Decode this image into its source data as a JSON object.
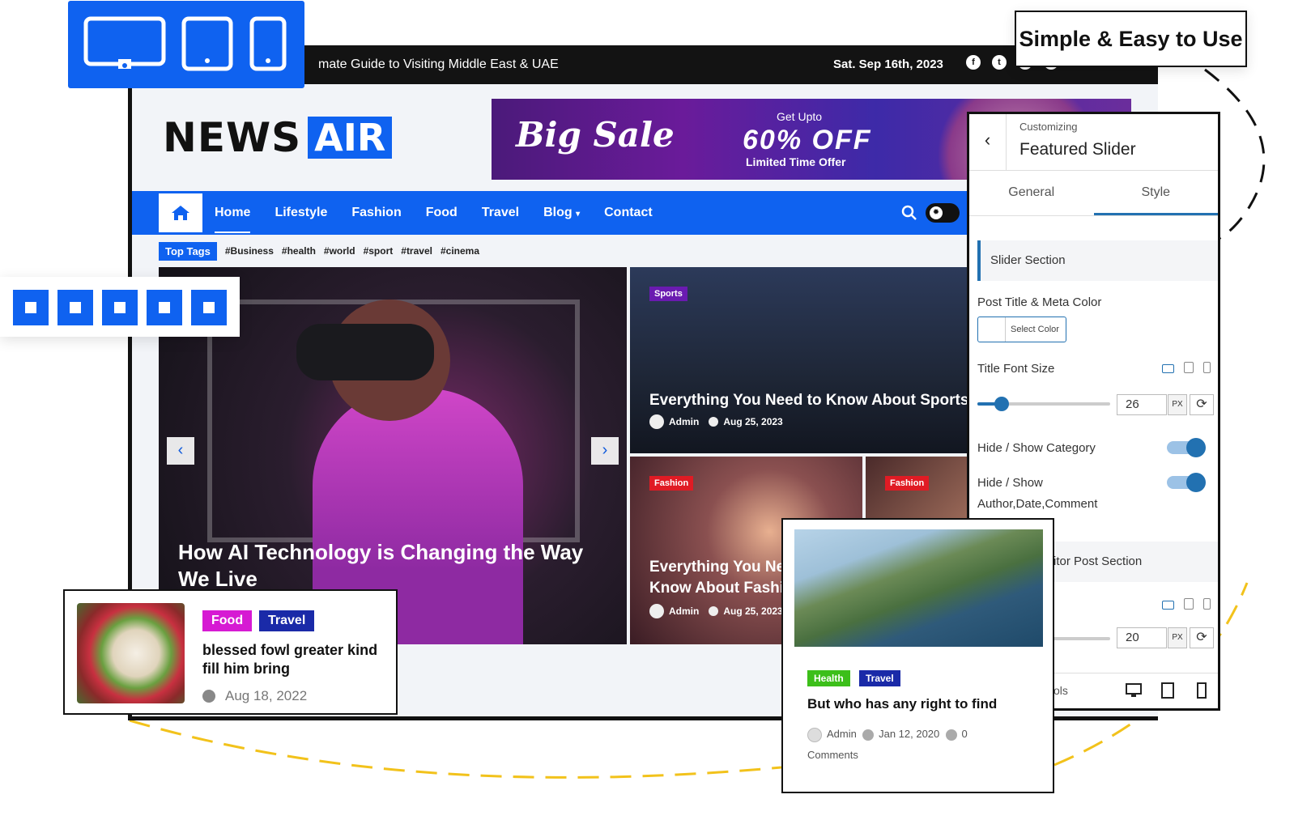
{
  "topbar": {
    "ticker": "mate Guide to Visiting Middle East & UAE",
    "date": "Sat. Sep 16th, 2023",
    "social": [
      "f",
      "t",
      "in",
      "ig"
    ]
  },
  "logo": {
    "news": "NEWS",
    "air": "AIR"
  },
  "banner": {
    "headline": "Big Sale",
    "upto": "Get Upto",
    "offer": "60% OFF",
    "limited": "Limited Time Offer"
  },
  "nav": {
    "home_icon": "home-icon",
    "items": [
      "Home",
      "Lifestyle",
      "Fashion",
      "Food",
      "Travel",
      "Blog",
      "Contact"
    ],
    "active": "Home"
  },
  "tags": {
    "label": "Top Tags",
    "items": [
      "#Business",
      "#health",
      "#world",
      "#sport",
      "#travel",
      "#cinema"
    ]
  },
  "hero": {
    "title": "How AI Technology is Changing the Way We Live",
    "prev": "‹",
    "next": "›"
  },
  "sports_card": {
    "category": "Sports",
    "title": "Everything You Need to Know About Sports",
    "author": "Admin",
    "date": "Aug 25, 2023"
  },
  "fashion_card": {
    "category": "Fashion",
    "title_line1": "Everything You Ne",
    "title_line2": "Know About Fashi",
    "author": "Admin",
    "date": "Aug 25, 2023"
  },
  "fashion_card2": {
    "category": "Fashion"
  },
  "promo": {
    "title": "Simple & Easy to Use"
  },
  "customizer": {
    "crumb": "Customizing",
    "title": "Featured Slider",
    "back": "‹",
    "tabs": [
      "General",
      "Style"
    ],
    "active_tab": "Style",
    "slider_section": "Slider Section",
    "post_title_color_label": "Post Title & Meta Color",
    "select_color": "Select Color",
    "title_font_size_label": "Title Font Size",
    "title_font_size": "26",
    "unit": "PX",
    "title_font_size_fraction": 0.18,
    "hide_show_category": "Hide / Show Category",
    "hide_show_author_line1": "Hide / Show",
    "hide_show_author_line2": "Author,Date,Comment",
    "editor_section": "itor Post Section",
    "second_font_size": "20",
    "second_font_size_fraction": 0.12,
    "footer_text": "ols"
  },
  "food_card": {
    "tags": [
      "Food",
      "Travel"
    ],
    "title": "blessed fowl greater kind fill him bring",
    "date": "Aug 18, 2022"
  },
  "health_card": {
    "tags": [
      "Health",
      "Travel"
    ],
    "title": "But who has any right to find",
    "author": "Admin",
    "date": "Jan 12, 2020",
    "comments_count": "0",
    "comments_label": "Comments"
  },
  "colors": {
    "brand": "#0f62f0",
    "sports": "#6a1bb0",
    "fashion": "#e01b24",
    "food": "#d61ad3",
    "travel": "#1a2aa8",
    "health": "#3cbf1a",
    "accent_wp": "#2271b1",
    "dash": "#f2c21b"
  }
}
